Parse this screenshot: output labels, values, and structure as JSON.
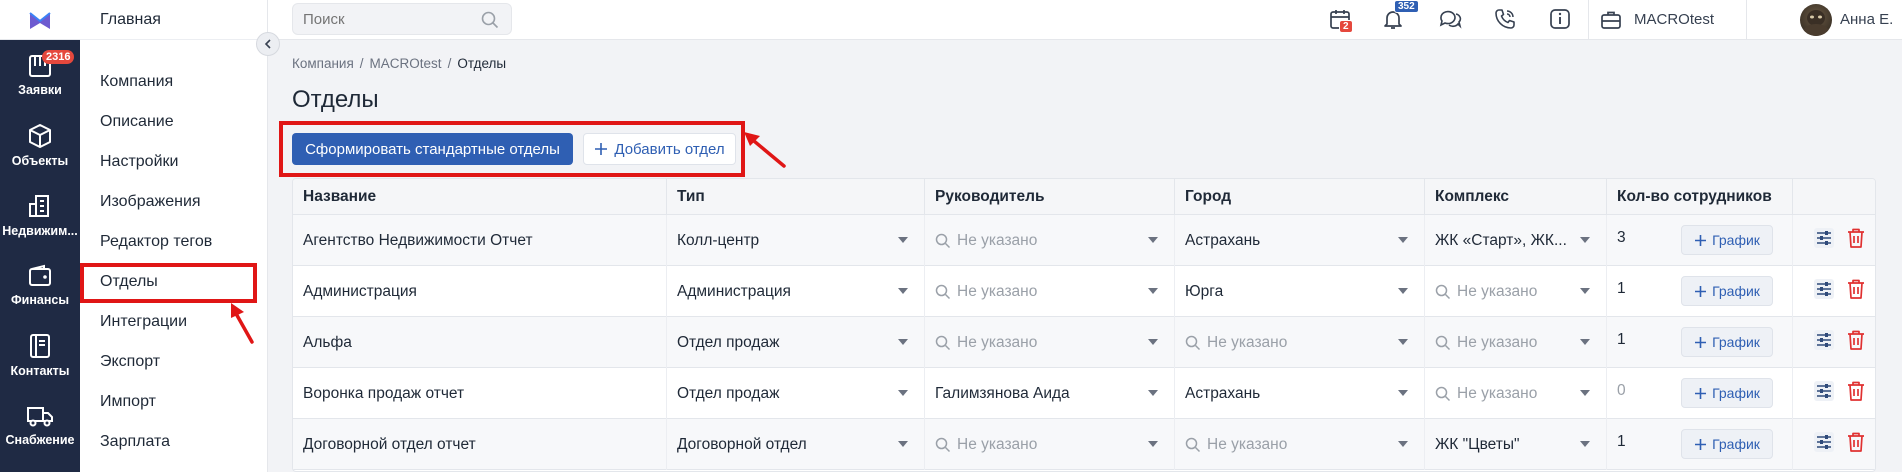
{
  "rail": {
    "items": [
      {
        "label": "Заявки",
        "badge": "2316"
      },
      {
        "label": "Объекты"
      },
      {
        "label": "Недвижим..."
      },
      {
        "label": "Финансы"
      },
      {
        "label": "Контакты"
      },
      {
        "label": "Снабжение"
      }
    ]
  },
  "sidebar": {
    "header": "Главная",
    "items": [
      {
        "label": "Компания"
      },
      {
        "label": "Описание"
      },
      {
        "label": "Настройки"
      },
      {
        "label": "Изображения"
      },
      {
        "label": "Редактор тегов"
      },
      {
        "label": "Отделы"
      },
      {
        "label": "Интеграции"
      },
      {
        "label": "Экспорт"
      },
      {
        "label": "Импорт"
      },
      {
        "label": "Зарплата"
      }
    ]
  },
  "header": {
    "search_placeholder": "Поиск",
    "calendar_badge": "2",
    "notifications_badge": "352",
    "company": "MACROtest",
    "user": "Анна Е."
  },
  "breadcrumb": {
    "item1": "Компания",
    "item2": "MACROtest",
    "current": "Отделы"
  },
  "page": {
    "title": "Отделы",
    "btn_generate": "Сформировать стандартные отделы",
    "btn_add": "Добавить отдел"
  },
  "table": {
    "columns": [
      "Название",
      "Тип",
      "Руководитель",
      "Город",
      "Комплекс",
      "Кол-во сотрудников"
    ],
    "placeholder": "Не указано",
    "graph_label": "График",
    "rows": [
      {
        "name": "Агентство Недвижимости Отчет",
        "type": "Колл-центр",
        "head": "",
        "city": "Астрахань",
        "complex": "ЖК «Старт», ЖК...",
        "count": "3"
      },
      {
        "name": "Администрация",
        "type": "Администрация",
        "head": "",
        "city": "Юрга",
        "complex": "",
        "count": "1"
      },
      {
        "name": "Альфа",
        "type": "Отдел продаж",
        "head": "",
        "city": "",
        "complex": "",
        "count": "1"
      },
      {
        "name": "Воронка продаж отчет",
        "type": "Отдел продаж",
        "head": "Галимзянова Аида",
        "city": "Астрахань",
        "complex": "",
        "count": "0"
      },
      {
        "name": "Договорной отдел отчет",
        "type": "Договорной отдел",
        "head": "",
        "city": "",
        "complex": "ЖК \"Цветы\"",
        "count": "1"
      }
    ]
  },
  "colors": {
    "accent": "#2f5fb3",
    "highlight": "#e01616",
    "rail": "#1f2a44",
    "delete": "#e03131"
  }
}
